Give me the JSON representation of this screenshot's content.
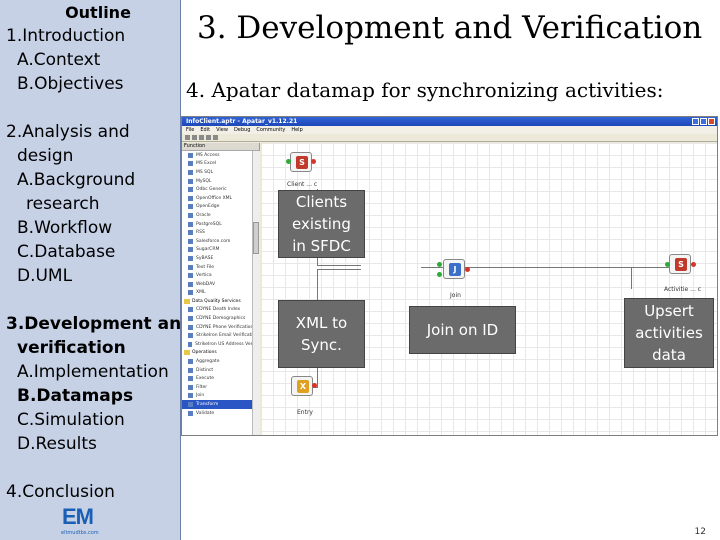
{
  "outline": {
    "title": "Outline",
    "items": [
      "1.Introduction",
      "A.Context",
      "B.Objectives",
      "2.Analysis and",
      "design",
      "A.Background",
      "research",
      "B.Workflow",
      "C.Database",
      "D.UML",
      "3.Development and",
      "verification",
      "A.Implementation",
      "B.Datamaps",
      "C.Simulation",
      "D.Results",
      "4.Conclusion"
    ]
  },
  "slide": {
    "title": "3. Development and Verification",
    "subtitle": "4. Apatar datamap for synchronizing activities:",
    "page_number": "12"
  },
  "logo": {
    "text": "EM",
    "sub": "eltmudtbs.com"
  },
  "apatar": {
    "window_title": "InfoClient.aptr - Apatar_v1.12.21",
    "menu": [
      "File",
      "Edit",
      "View",
      "Debug",
      "Community",
      "Help"
    ],
    "palette_header": "Function",
    "palette_items": [
      "MS Access",
      "MS Excel",
      "MS SQL",
      "MySQL",
      "Odbc Generic",
      "OpenOffice XML",
      "OpenEdge",
      "Oracle",
      "PostgreSQL",
      "RSS",
      "Salesforce.com",
      "SugarCRM",
      "SyBASE",
      "Text File",
      "Vertica",
      "WebDAV",
      "XML"
    ],
    "palette_group_dqs": "Data Quality Services",
    "palette_dqs_items": [
      "CDYNE Death Index",
      "CDYNE Demographics",
      "CDYNE Phone Verification",
      "StrikeIron Email Verification",
      "StrikeIron US Address Verific"
    ],
    "palette_group_ops": "Operations",
    "palette_ops_items": [
      "Aggregate",
      "Distinct",
      "Execute",
      "Filter",
      "Join",
      "Transform",
      "Validate"
    ],
    "nodes": {
      "client": "Client ... c",
      "join": "Join",
      "activities": "Activitie ... c",
      "entry": "Entry"
    }
  },
  "callouts": {
    "clients_existing": "Clients\nexisting\nin SFDC",
    "xml_to_sync": "XML to\nSync.",
    "join_on_id": "Join on ID",
    "upsert": "Upsert\nactivities\ndata"
  }
}
